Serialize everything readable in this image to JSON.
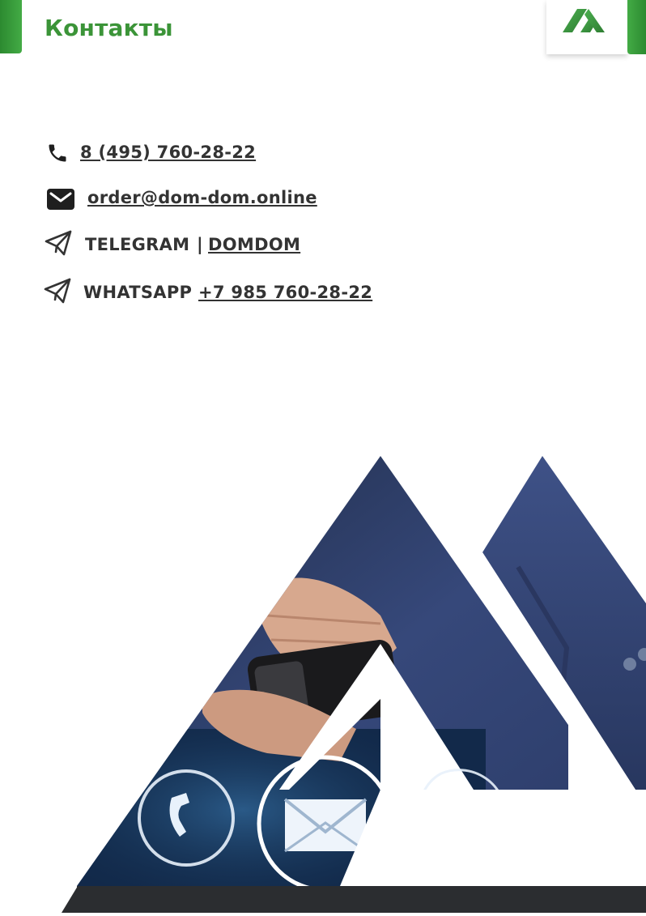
{
  "header": {
    "title": "Контакты"
  },
  "contacts": {
    "phone": {
      "icon": "phone-icon",
      "value": "8 (495) 760-28-22"
    },
    "email": {
      "icon": "mail-icon",
      "value": "order@dom-dom.online"
    },
    "telegram": {
      "icon": "paper-plane-icon",
      "label": "TELEGRAM",
      "separator": "|",
      "link": "DOMDOM"
    },
    "whatsapp": {
      "icon": "paper-plane-icon",
      "label": "WHATSAPP",
      "link": "+7 985 760-28-22"
    }
  },
  "colors": {
    "brand_green": "#3b9438",
    "link_blue": "#1a5fb4",
    "text_dark": "#333333",
    "bar_dark": "#2b2d30"
  }
}
